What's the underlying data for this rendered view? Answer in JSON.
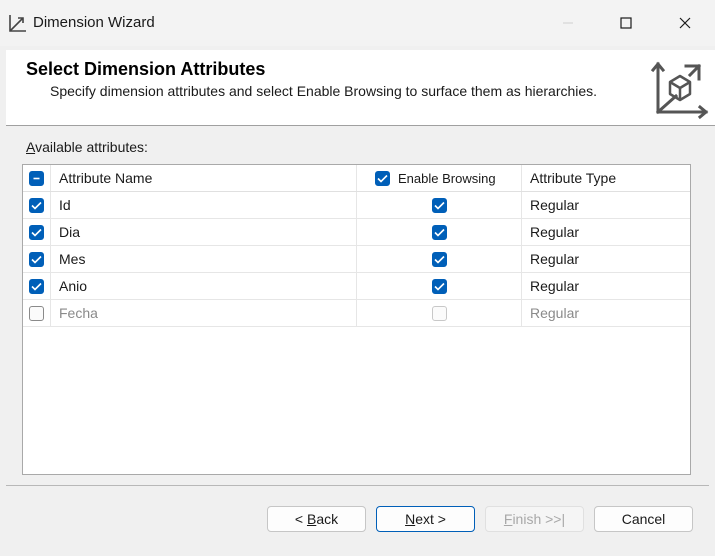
{
  "window": {
    "title": "Dimension Wizard"
  },
  "header": {
    "title": "Select Dimension Attributes",
    "subtitle": "Specify dimension attributes and select Enable Browsing to surface them as hierarchies."
  },
  "attributes_label": "Available attributes:",
  "grid": {
    "columns": {
      "name": "Attribute Name",
      "enable_browsing": "Enable Browsing",
      "type": "Attribute Type"
    },
    "header_select_state": "indeterminate",
    "header_enable_browsing_checked": true,
    "rows": [
      {
        "selected": true,
        "name": "Id",
        "enable_browsing": true,
        "type": "Regular",
        "enabled": true
      },
      {
        "selected": true,
        "name": "Dia",
        "enable_browsing": true,
        "type": "Regular",
        "enabled": true
      },
      {
        "selected": true,
        "name": "Mes",
        "enable_browsing": true,
        "type": "Regular",
        "enabled": true
      },
      {
        "selected": true,
        "name": "Anio",
        "enable_browsing": true,
        "type": "Regular",
        "enabled": true
      },
      {
        "selected": false,
        "name": "Fecha",
        "enable_browsing": false,
        "type": "Regular",
        "enabled": false
      }
    ]
  },
  "buttons": {
    "back": "< Back",
    "next": "Next >",
    "finish": "Finish >>|",
    "cancel": "Cancel"
  },
  "colors": {
    "accent": "#005fb8",
    "window_bg": "#f0f0f0",
    "header_bg": "#ffffff"
  }
}
